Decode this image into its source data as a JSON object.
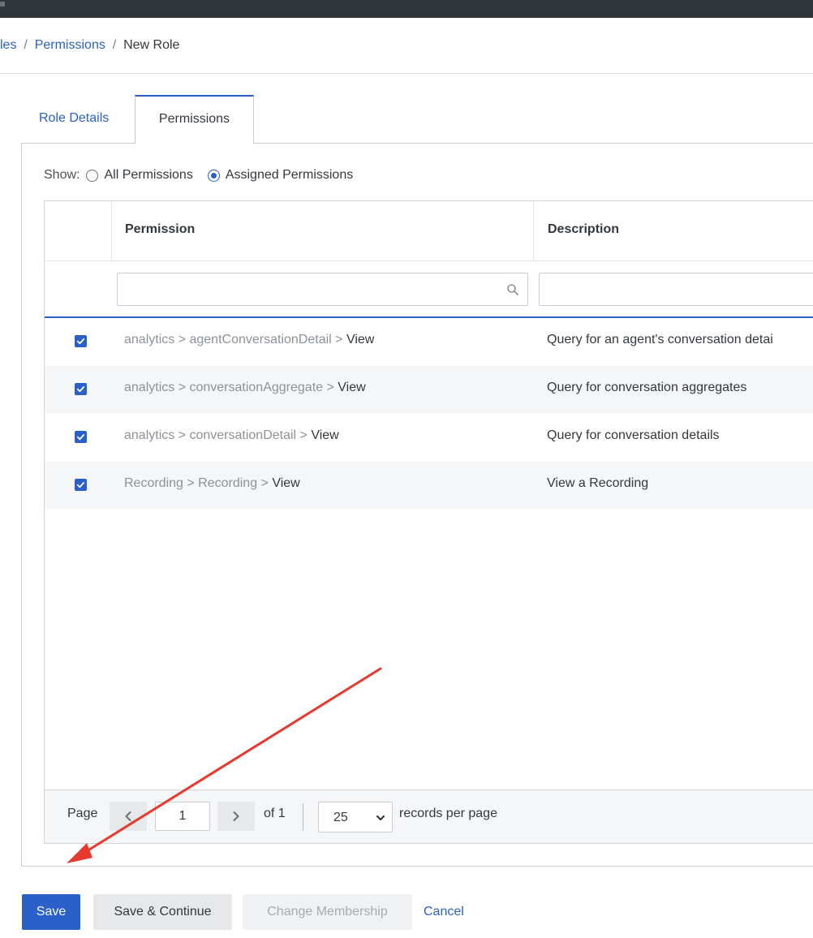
{
  "breadcrumb": {
    "items": [
      "les",
      "Permissions"
    ],
    "separator": "/",
    "current": "New Role"
  },
  "tabs": [
    {
      "label": "Role Details",
      "active": false
    },
    {
      "label": "Permissions",
      "active": true
    }
  ],
  "show": {
    "label": "Show:",
    "options": [
      {
        "label": "All Permissions",
        "selected": false
      },
      {
        "label": "Assigned Permissions",
        "selected": true
      }
    ]
  },
  "grid": {
    "columns": [
      "Permission",
      "Description"
    ],
    "rows": [
      {
        "checked": true,
        "path": "analytics > agentConversationDetail > ",
        "action": "View",
        "description": "Query for an agent's conversation detai"
      },
      {
        "checked": true,
        "path": "analytics > conversationAggregate > ",
        "action": "View",
        "description": "Query for conversation aggregates"
      },
      {
        "checked": true,
        "path": "analytics > conversationDetail > ",
        "action": "View",
        "description": "Query for conversation details"
      },
      {
        "checked": true,
        "path": "Recording > Recording > ",
        "action": "View",
        "description": "View a Recording"
      }
    ]
  },
  "pager": {
    "page_label": "Page",
    "current_page": "1",
    "of_label": "of 1",
    "per_page": "25",
    "per_page_label": "records per page"
  },
  "actions": {
    "save": "Save",
    "save_continue": "Save & Continue",
    "change_membership": "Change Membership",
    "cancel": "Cancel"
  },
  "colors": {
    "accent": "#2a60c8",
    "annotation_arrow": "#e8392f"
  }
}
